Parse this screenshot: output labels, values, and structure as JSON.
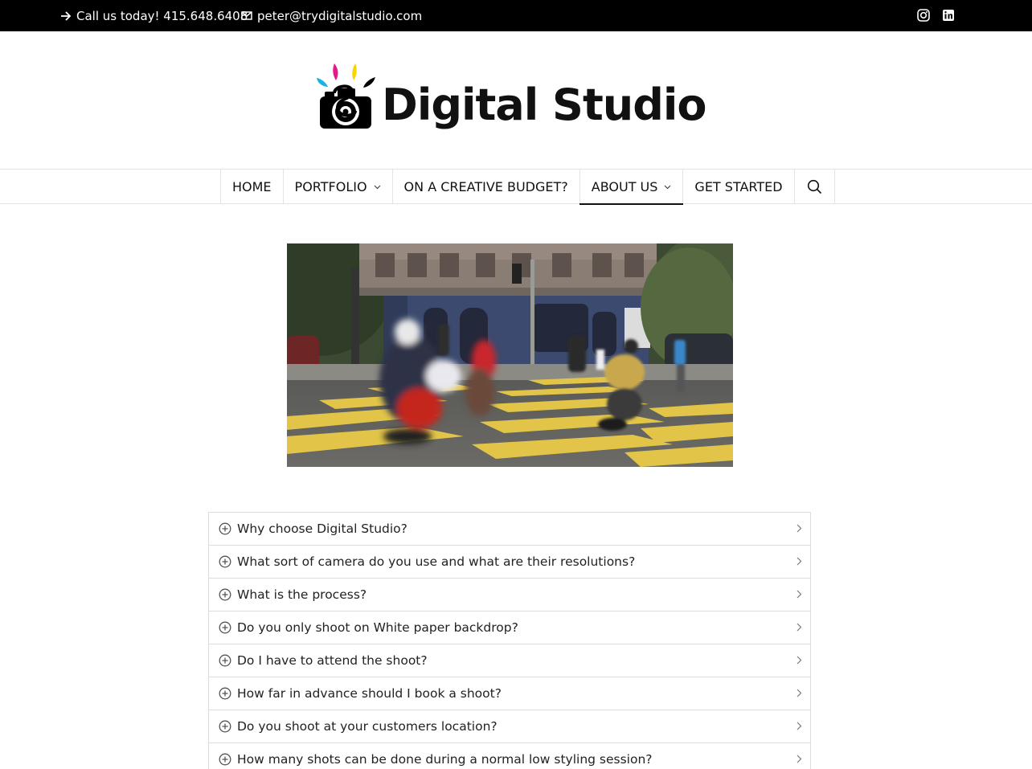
{
  "topbar": {
    "phone_text": "Call us today! 415.648.6408",
    "email_text": "peter@trydigitalstudio.com",
    "social": [
      "instagram-icon",
      "linkedin-icon"
    ]
  },
  "logo": {
    "brand": "Digital Studio",
    "colors": {
      "cyan": "#1ab3e6",
      "magenta": "#e6198a",
      "yellow": "#f5d400",
      "black": "#000000"
    }
  },
  "nav": {
    "items": [
      {
        "label": "HOME"
      },
      {
        "label": "PORTFOLIO",
        "has_dropdown": true
      },
      {
        "label": "ON A CREATIVE BUDGET?"
      },
      {
        "label": "ABOUT US",
        "has_dropdown": true,
        "active": true
      },
      {
        "label": "GET STARTED"
      }
    ],
    "search_icon": "search-icon"
  },
  "faq": {
    "items": [
      "Why choose Digital Studio?",
      "What sort of camera do you use and what are their resolutions?",
      "What is the process?",
      "Do you only shoot on White paper backdrop?",
      "Do I have to attend the shoot?",
      "How far in advance should I book a shoot?",
      "Do you shoot at your customers location?",
      "How many shots can be done during a normal low styling session?"
    ]
  }
}
